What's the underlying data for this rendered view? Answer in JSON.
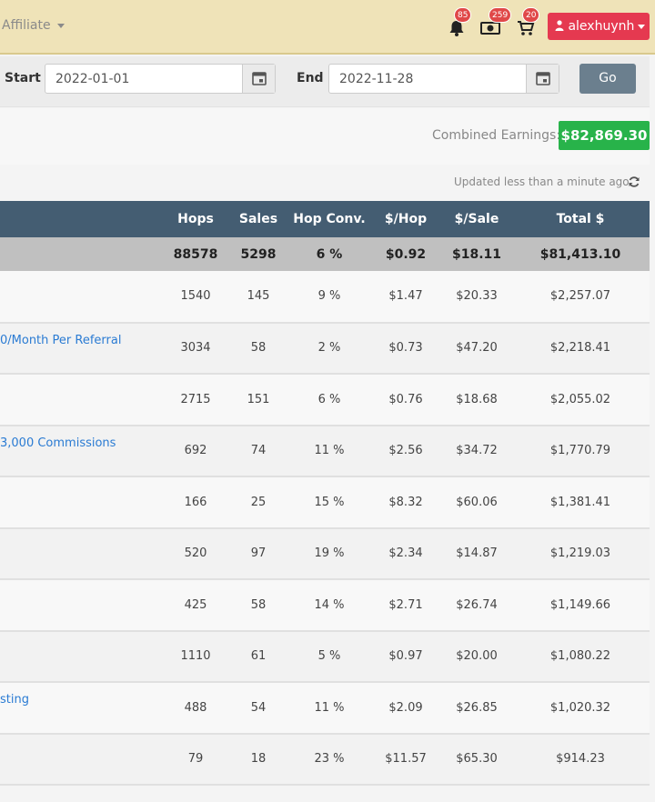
{
  "topbar": {
    "affiliate_label": "Affiliate",
    "notifications_count": "85",
    "earnings_count": "259",
    "cart_count": "20",
    "user_name": "alexhuynh"
  },
  "filters": {
    "start_label": "Start",
    "start_value": "2022-01-01",
    "end_label": "End",
    "end_value": "2022-11-28",
    "go_label": "Go"
  },
  "earnings": {
    "label": "Combined Earnings:",
    "value": "$82,869.30"
  },
  "updated_text": "Updated less than a minute ago",
  "table": {
    "headers": [
      "",
      "Hops",
      "Sales",
      "Hop Conv.",
      "$/Hop",
      "$/Sale",
      "Total $"
    ],
    "total": [
      "",
      "88578",
      "5298",
      "6 %",
      "$0.92",
      "$18.11",
      "$81,413.10"
    ],
    "rows": [
      {
        "name": "",
        "hops": "1540",
        "sales": "145",
        "conv": "9 %",
        "per_hop": "$1.47",
        "per_sale": "$20.33",
        "total": "$2,257.07"
      },
      {
        "name": "0/Month Per Referral",
        "hops": "3034",
        "sales": "58",
        "conv": "2 %",
        "per_hop": "$0.73",
        "per_sale": "$47.20",
        "total": "$2,218.41"
      },
      {
        "name": "",
        "hops": "2715",
        "sales": "151",
        "conv": "6 %",
        "per_hop": "$0.76",
        "per_sale": "$18.68",
        "total": "$2,055.02"
      },
      {
        "name": "3,000 Commissions",
        "hops": "692",
        "sales": "74",
        "conv": "11 %",
        "per_hop": "$2.56",
        "per_sale": "$34.72",
        "total": "$1,770.79"
      },
      {
        "name": "",
        "hops": "166",
        "sales": "25",
        "conv": "15 %",
        "per_hop": "$8.32",
        "per_sale": "$60.06",
        "total": "$1,381.41"
      },
      {
        "name": "",
        "hops": "520",
        "sales": "97",
        "conv": "19 %",
        "per_hop": "$2.34",
        "per_sale": "$14.87",
        "total": "$1,219.03"
      },
      {
        "name": "",
        "hops": "425",
        "sales": "58",
        "conv": "14 %",
        "per_hop": "$2.71",
        "per_sale": "$26.74",
        "total": "$1,149.66"
      },
      {
        "name": "",
        "hops": "1110",
        "sales": "61",
        "conv": "5 %",
        "per_hop": "$0.97",
        "per_sale": "$20.00",
        "total": "$1,080.22"
      },
      {
        "name": "sting",
        "hops": "488",
        "sales": "54",
        "conv": "11 %",
        "per_hop": "$2.09",
        "per_sale": "$26.85",
        "total": "$1,020.32"
      },
      {
        "name": "",
        "hops": "79",
        "sales": "18",
        "conv": "23 %",
        "per_hop": "$11.57",
        "per_sale": "$65.30",
        "total": "$914.23"
      }
    ]
  }
}
